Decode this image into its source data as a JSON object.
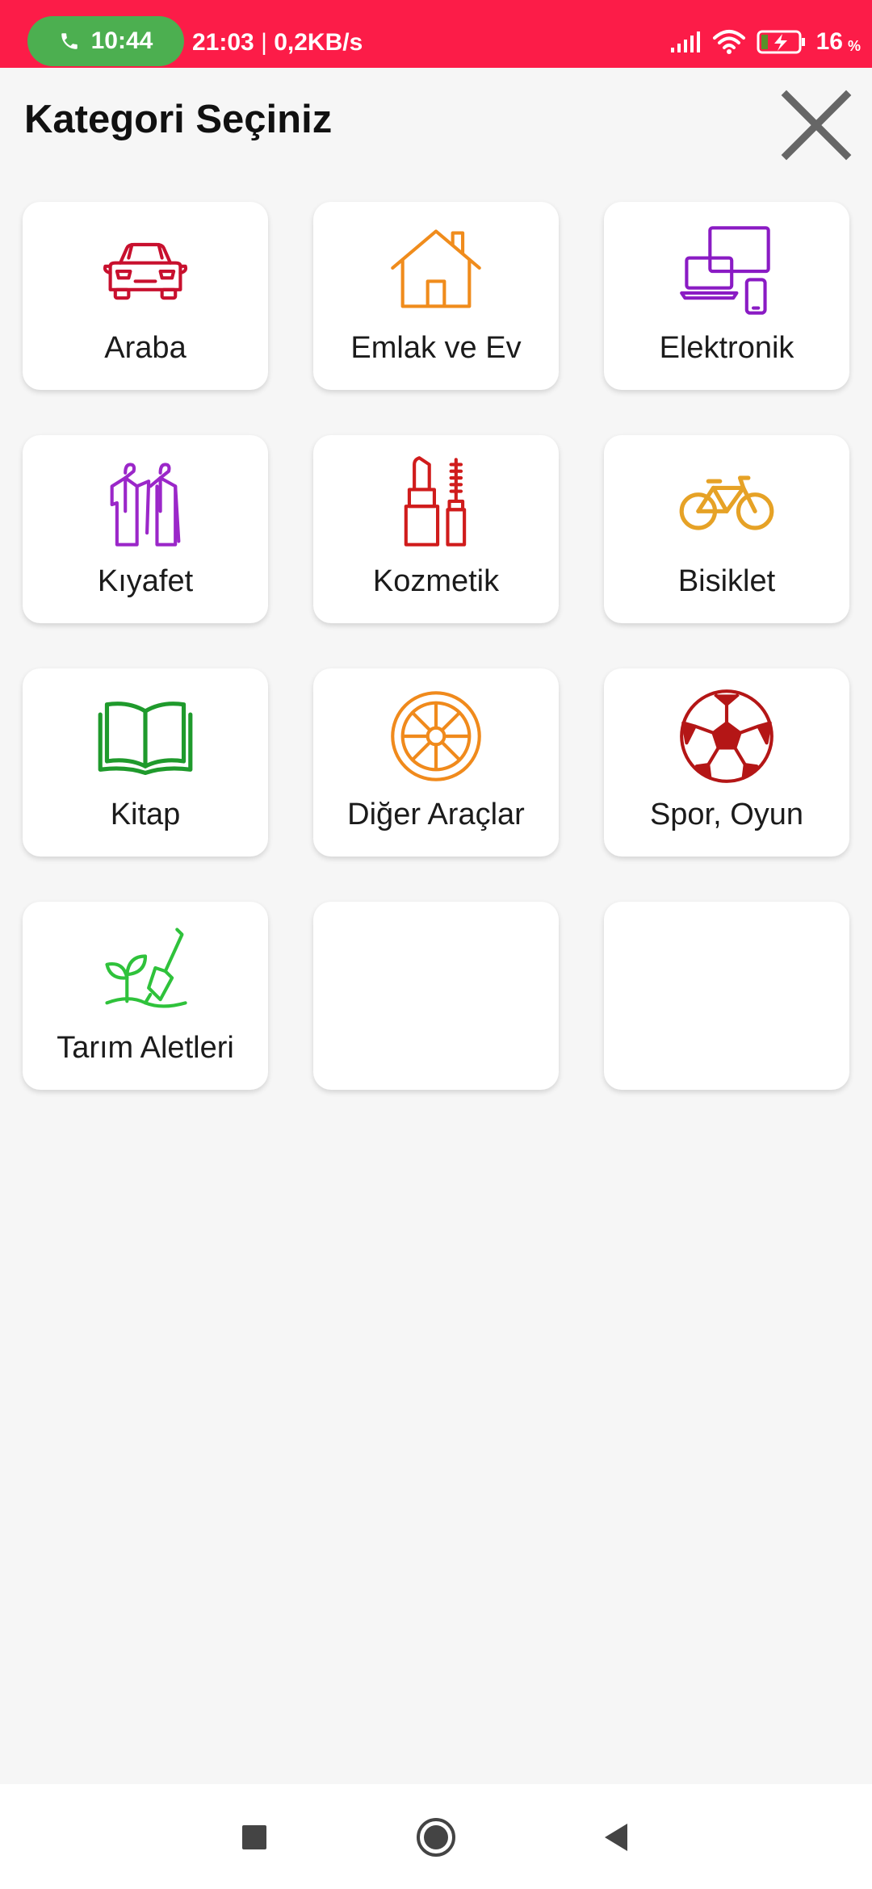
{
  "status_bar": {
    "call_time": "10:44",
    "clock": "21:03",
    "network_speed": "0,2KB/s",
    "battery_percent": "16",
    "battery_unit": "%"
  },
  "header": {
    "title": "Kategori Seçiniz",
    "close_icon": "close-icon"
  },
  "categories": [
    {
      "label": "Araba",
      "icon": "car-icon",
      "color": "#c8102e"
    },
    {
      "label": "Emlak ve Ev",
      "icon": "house-icon",
      "color": "#f08c1c"
    },
    {
      "label": "Elektronik",
      "icon": "devices-icon",
      "color": "#8a1bc4"
    },
    {
      "label": "Kıyafet",
      "icon": "clothes-icon",
      "color": "#9b27c9"
    },
    {
      "label": "Kozmetik",
      "icon": "lipstick-mascara-icon",
      "color": "#d01c1c"
    },
    {
      "label": "Bisiklet",
      "icon": "bicycle-icon",
      "color": "#e6a226"
    },
    {
      "label": "Kitap",
      "icon": "book-icon",
      "color": "#1f9a2c"
    },
    {
      "label": "Diğer Araçlar",
      "icon": "wheel-icon",
      "color": "#f08a1c"
    },
    {
      "label": "Spor, Oyun",
      "icon": "soccer-ball-icon",
      "color": "#b41616"
    },
    {
      "label": "Tarım Aletleri",
      "icon": "gardening-icon",
      "color": "#2fc23b"
    }
  ],
  "nav_bar": {
    "recents_icon": "square-icon",
    "home_icon": "circle-icon",
    "back_icon": "triangle-back-icon"
  }
}
